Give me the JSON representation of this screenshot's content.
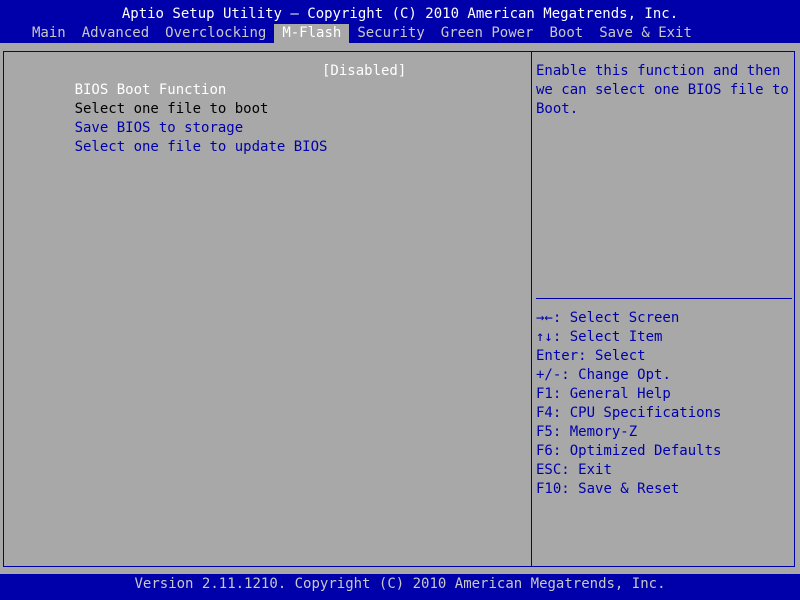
{
  "header": {
    "title": "Aptio Setup Utility – Copyright (C) 2010 American Megatrends, Inc."
  },
  "tabs": [
    {
      "label": "Main",
      "active": false
    },
    {
      "label": "Advanced",
      "active": false
    },
    {
      "label": "Overclocking",
      "active": false
    },
    {
      "label": "M-Flash",
      "active": true
    },
    {
      "label": "Security",
      "active": false
    },
    {
      "label": "Green Power",
      "active": false
    },
    {
      "label": "Boot",
      "active": false
    },
    {
      "label": "Save & Exit",
      "active": false
    }
  ],
  "main": {
    "rows": [
      {
        "label": "BIOS Boot Function",
        "value": "[Disabled]",
        "style": "title"
      },
      {
        "label": "Select one file to boot",
        "value": "",
        "style": "text"
      },
      {
        "label": "Save BIOS to storage",
        "value": "",
        "style": "link"
      },
      {
        "label": "Select one file to update BIOS",
        "value": "",
        "style": "link"
      }
    ]
  },
  "help": {
    "lines": [
      "Enable this function and then",
      "we can select one BIOS file to",
      "Boot."
    ]
  },
  "keys": [
    {
      "key": "→←",
      "desc": ": Select Screen"
    },
    {
      "key": "↑↓",
      "desc": ": Select Item"
    },
    {
      "key": "Enter",
      "desc": ": Select"
    },
    {
      "key": "+/-",
      "desc": ": Change Opt."
    },
    {
      "key": "F1",
      "desc": ": General Help"
    },
    {
      "key": "F4",
      "desc": ": CPU Specifications"
    },
    {
      "key": "F5",
      "desc": ": Memory-Z"
    },
    {
      "key": "F6",
      "desc": ": Optimized Defaults"
    },
    {
      "key": "ESC",
      "desc": ": Exit"
    },
    {
      "key": "F10",
      "desc": ": Save & Reset"
    }
  ],
  "footer": {
    "text": "Version 2.11.1210. Copyright (C) 2010 American Megatrends, Inc."
  },
  "colors": {
    "bar_blue": "#0000aa",
    "panel_gray": "#a8a8a8",
    "text_white": "#ffffff",
    "text_black": "#000000"
  }
}
